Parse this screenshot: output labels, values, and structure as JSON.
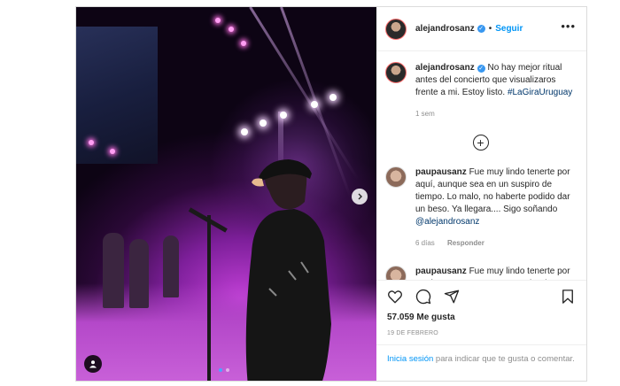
{
  "post": {
    "username": "alejandrosanz",
    "follow_label": "Seguir",
    "separator": "•",
    "more_label": "•••"
  },
  "caption": {
    "username": "alejandrosanz",
    "text": "No hay mejor ritual antes del concierto que visualizaros frente a mi. Estoy listo.",
    "hashtag": "#LaGiraUruguay",
    "time": "1 sem"
  },
  "comments": [
    {
      "username": "paupausanz",
      "text": "Fue muy lindo tenerte por aquí, aunque sea en un suspiro de tiempo. Lo malo, no haberte podido dar un beso. Ya llegara.... Sigo soñando",
      "mention": "@alejandrosanz",
      "time": "6 días",
      "reply_label": "Responder"
    },
    {
      "username": "paupausanz",
      "text": "Fue muy lindo tenerte por aquí, aunque sea en un suspiro de"
    }
  ],
  "likes": "57.059 Me gusta",
  "date": "19 DE FEBRERO",
  "login": {
    "link": "Inicia sesión",
    "text": "para indicar que te gusta o comentar."
  },
  "colors": {
    "accent": "#0095f6",
    "verified": "#3897f0",
    "stage": "#c13fd6"
  },
  "icons": [
    "heart-icon",
    "comment-icon",
    "share-icon",
    "bookmark-icon",
    "plus-icon",
    "tag-user-icon",
    "chevron-right-icon"
  ]
}
